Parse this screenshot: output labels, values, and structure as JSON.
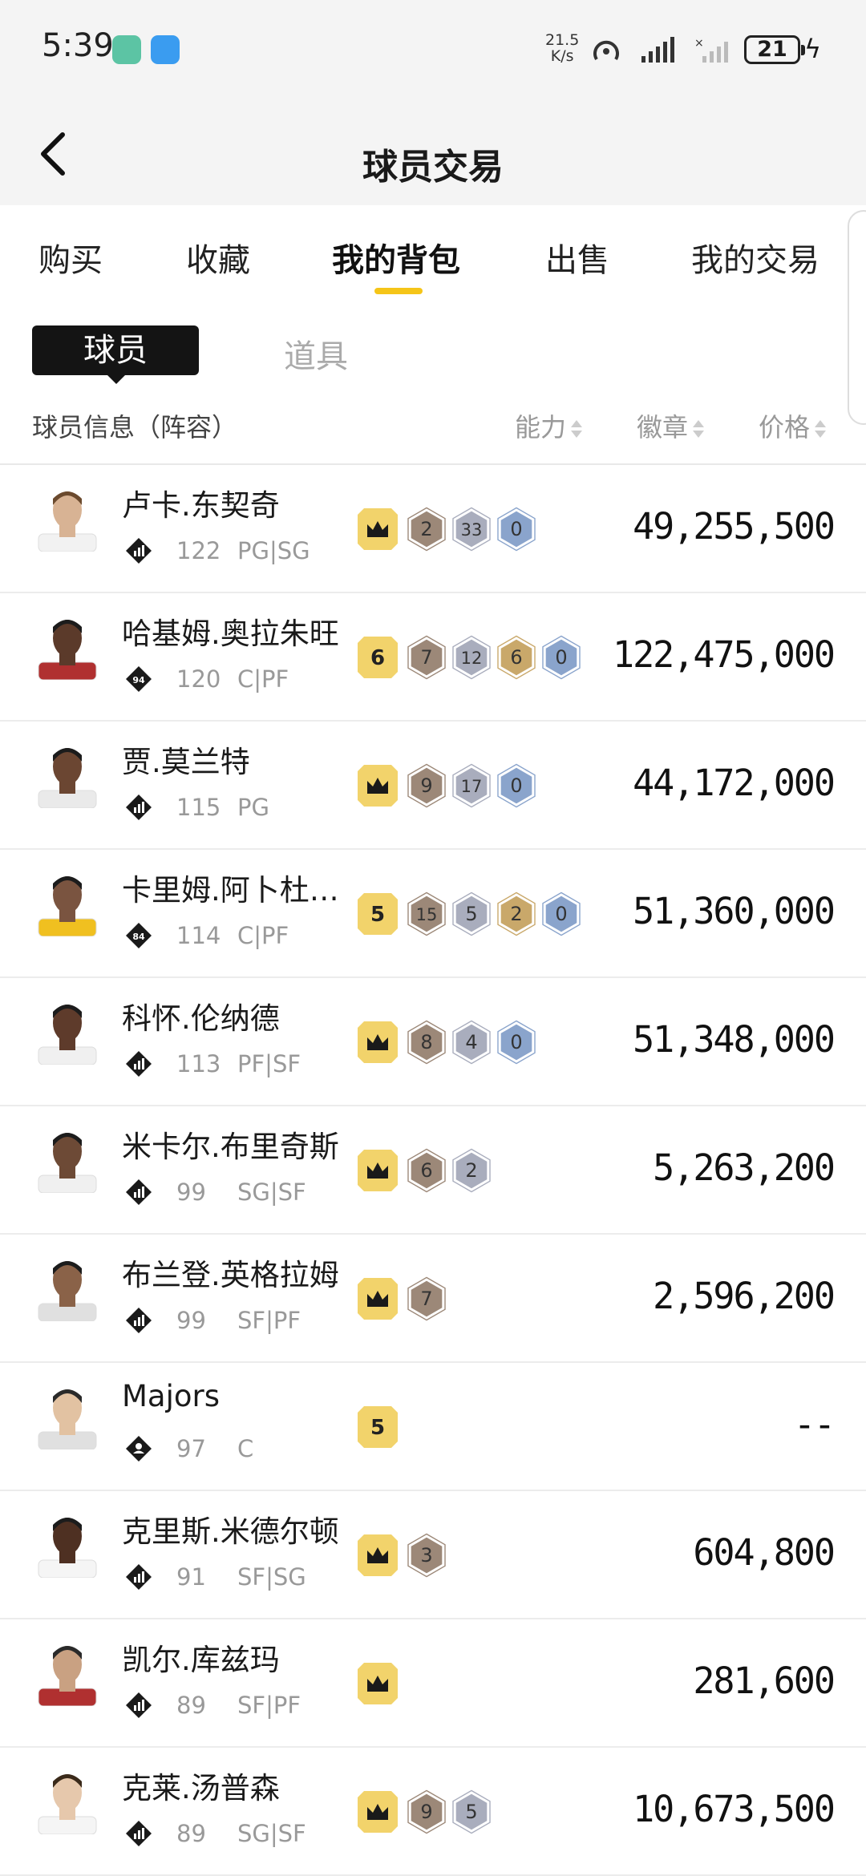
{
  "status_bar": {
    "time": "5:39",
    "net_speed_top": "21.5",
    "net_speed_bottom": "K/s",
    "battery": "21"
  },
  "nav": {
    "title": "球员交易"
  },
  "tabs": [
    {
      "label": "购买"
    },
    {
      "label": "收藏"
    },
    {
      "label": "我的背包"
    },
    {
      "label": "出售"
    },
    {
      "label": "我的交易"
    }
  ],
  "active_tab": "我的背包",
  "subtabs": {
    "active": "球员",
    "inactive": "道具"
  },
  "table_header": {
    "info": "球员信息（阵容）",
    "ability": "能力",
    "badge": "徽章",
    "price": "价格"
  },
  "players": [
    {
      "name": "卢卡.东契奇",
      "rating": "122",
      "position": "PG|SG",
      "tier": "crown",
      "badges": [
        [
          "bronze",
          "2"
        ],
        [
          "silver",
          "33"
        ],
        [
          "blue",
          "0"
        ]
      ],
      "price": "49,255,500"
    },
    {
      "name": "哈基姆.奥拉朱旺",
      "rating": "120",
      "position": "C|PF",
      "tier": "6",
      "tier_level": "94",
      "badges": [
        [
          "bronze",
          "7"
        ],
        [
          "silver",
          "12"
        ],
        [
          "gold",
          "6"
        ],
        [
          "blue",
          "0"
        ]
      ],
      "price": "122,475,000"
    },
    {
      "name": "贾.莫兰特",
      "rating": "115",
      "position": "PG",
      "tier": "crown",
      "badges": [
        [
          "bronze",
          "9"
        ],
        [
          "silver",
          "17"
        ],
        [
          "blue",
          "0"
        ]
      ],
      "price": "44,172,000"
    },
    {
      "name": "卡里姆.阿卜杜…",
      "rating": "114",
      "position": "C|PF",
      "tier": "5",
      "tier_level": "84",
      "badges": [
        [
          "bronze",
          "15"
        ],
        [
          "silver",
          "5"
        ],
        [
          "gold",
          "2"
        ],
        [
          "blue",
          "0"
        ]
      ],
      "price": "51,360,000"
    },
    {
      "name": "科怀.伦纳德",
      "rating": "113",
      "position": "PF|SF",
      "tier": "crown",
      "badges": [
        [
          "bronze",
          "8"
        ],
        [
          "silver",
          "4"
        ],
        [
          "blue",
          "0"
        ]
      ],
      "price": "51,348,000"
    },
    {
      "name": "米卡尔.布里奇斯",
      "rating": "99",
      "position": "SG|SF",
      "tier": "crown",
      "badges": [
        [
          "bronze",
          "6"
        ],
        [
          "silver",
          "2"
        ]
      ],
      "price": "5,263,200"
    },
    {
      "name": "布兰登.英格拉姆",
      "rating": "99",
      "position": "SF|PF",
      "tier": "crown",
      "badges": [
        [
          "bronze",
          "7"
        ]
      ],
      "price": "2,596,200"
    },
    {
      "name": "Majors",
      "rating": "97",
      "position": "C",
      "tier": "5",
      "badges": [],
      "price": "--",
      "icon": "person"
    },
    {
      "name": "克里斯.米德尔顿",
      "rating": "91",
      "position": "SF|SG",
      "tier": "crown",
      "badges": [
        [
          "bronze",
          "3"
        ]
      ],
      "price": "604,800"
    },
    {
      "name": "凯尔.库兹玛",
      "rating": "89",
      "position": "SF|PF",
      "tier": "crown",
      "badges": [],
      "price": "281,600"
    },
    {
      "name": "克莱.汤普森",
      "rating": "89",
      "position": "SG|SF",
      "tier": "crown",
      "badges": [
        [
          "bronze",
          "9"
        ],
        [
          "silver",
          "5"
        ]
      ],
      "price": "10,673,500"
    }
  ],
  "colors": {
    "accent": "#f5c518",
    "badge_bronze": "#9c8878",
    "badge_silver": "#a9adbd",
    "badge_gold": "#c9a86a",
    "badge_blue": "#8aa4cc",
    "tier_yellow": "#f2d36b"
  }
}
